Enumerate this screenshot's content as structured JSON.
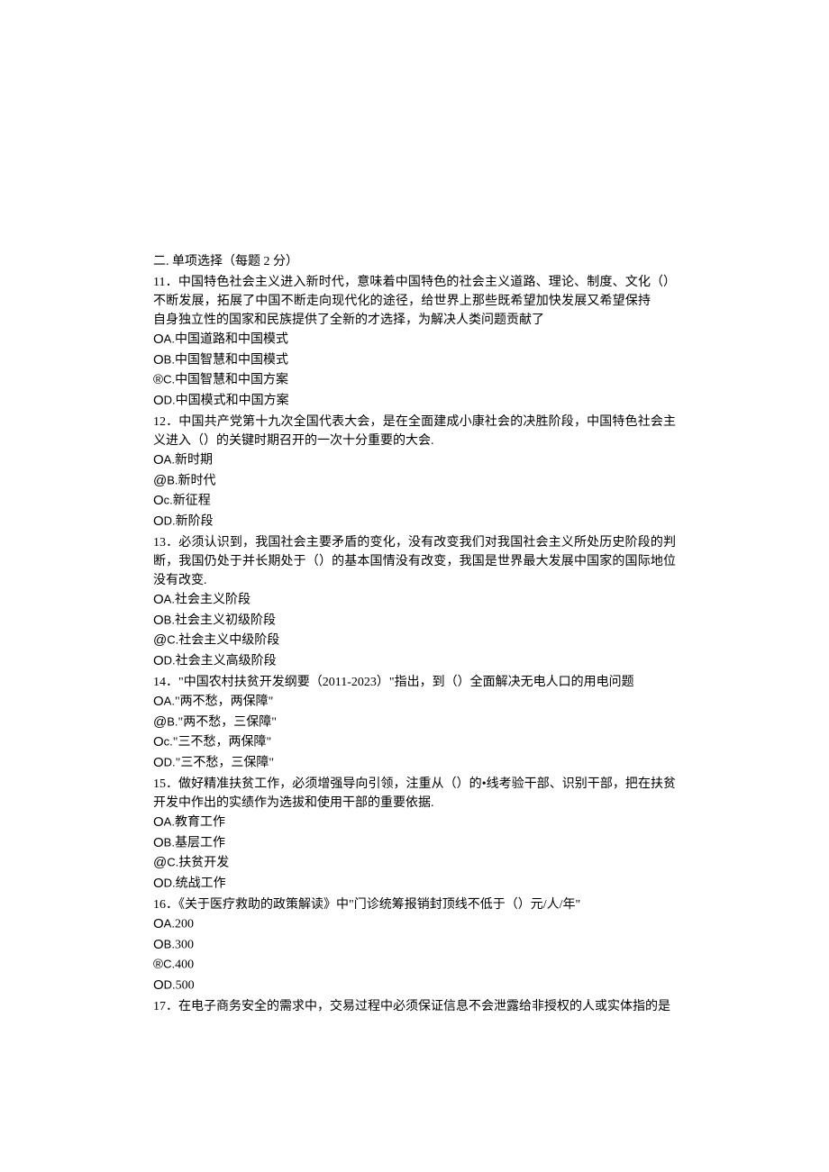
{
  "section_title": "二. 单项选择（每题 2 分）",
  "questions": [
    {
      "num": "11",
      "stem_lines": [
        "．中国特色社会主义进入新时代，意味着中国特色的社会主义道路、理论、制度、文化不断发展，拓展了中国不断走向现代化的途径，给世界上那些既希望加快发展又希望保持自身独立性的国家和民族提供了全新的才选择，为解决人类问题贡献了"
      ],
      "blank_trail": "（）",
      "options": [
        {
          "marker": "O",
          "label": "A.",
          "text": "中国道路和中国模式"
        },
        {
          "marker": "O",
          "label": "B.",
          "text": "中国智慧和中国模式"
        },
        {
          "marker": "®",
          "label": "C.",
          "text": "中国智慧和中国方案"
        },
        {
          "marker": "O",
          "label": "D.",
          "text": "中国模式和中国方案"
        }
      ]
    },
    {
      "num": "12",
      "stem_lines": [
        "．中国共产党第十九次全国代表大会，是在全面建成小康社会的决胜阶段，中国特色社会主义进入（）的关键时期召开的一次十分重要的大会."
      ],
      "options": [
        {
          "marker": "O",
          "label": "A.",
          "text": "新时期"
        },
        {
          "marker": "@",
          "label": "B.",
          "text": "新时代"
        },
        {
          "marker": "O",
          "label": "c.",
          "text": "新征程"
        },
        {
          "marker": "O",
          "label": "D.",
          "text": "新阶段"
        }
      ]
    },
    {
      "num": "13",
      "stem_lines": [
        "．必须认识到，我国社会主要矛盾的变化，没有改变我们对我国社会主义所处历史阶段的判断，我国仍处于并长期处于（）的基本国情没有改变，我国是世界最大发展中国家的国际地位没有改变."
      ],
      "options": [
        {
          "marker": "O",
          "label": "A.",
          "text": "社会主义阶段"
        },
        {
          "marker": "O",
          "label": "B.",
          "text": "社会主义初级阶段"
        },
        {
          "marker": "@",
          "label": "C.",
          "text": "社会主义中级阶段"
        },
        {
          "marker": "O",
          "label": "D.",
          "text": "社会主义高级阶段"
        }
      ]
    },
    {
      "num": "14",
      "stem_lines": [
        "．\"中国农村扶贫开发纲要（2011-2023）\"指出，到（）全面解决无电人口的用电问题"
      ],
      "options": [
        {
          "marker": "O",
          "label": "A.",
          "text": "\"两不愁，两保障\""
        },
        {
          "marker": "@",
          "label": "B.",
          "text": "\"两不愁，三保障\""
        },
        {
          "marker": "O",
          "label": "c.",
          "text": "\"三不愁，两保障\""
        },
        {
          "marker": "O",
          "label": "D.",
          "text": "\"三不愁，三保障\""
        }
      ]
    },
    {
      "num": "15",
      "stem_lines": [
        "．做好精准扶贫工作，必须增强导向引领，注重从（）的•线考验干部、识别干部，把在扶贫开发中作出的实绩作为选拔和使用干部的重要依据."
      ],
      "options": [
        {
          "marker": "O",
          "label": "A.",
          "text": "教育工作"
        },
        {
          "marker": "O",
          "label": "B.",
          "text": "基层工作"
        },
        {
          "marker": "@",
          "label": "C.",
          "text": "扶贫开发"
        },
        {
          "marker": "O",
          "label": "D.",
          "text": "统战工作"
        }
      ]
    },
    {
      "num": "16",
      "stem_lines": [
        "．《关于医疗救助的政策解读》中\"门诊统筹报销封顶线不低于（）元/人/年\""
      ],
      "options": [
        {
          "marker": "O",
          "label": "A.",
          "text": "200"
        },
        {
          "marker": "O",
          "label": "B.",
          "text": "300"
        },
        {
          "marker": "®",
          "label": "C.",
          "text": "400"
        },
        {
          "marker": "O",
          "label": "D.",
          "text": "500"
        }
      ]
    },
    {
      "num": "17",
      "stem_lines": [
        "．在电子商务安全的需求中，交易过程中必须保证信息不会泄露给非授权的人或实体指的是"
      ],
      "options": []
    }
  ]
}
